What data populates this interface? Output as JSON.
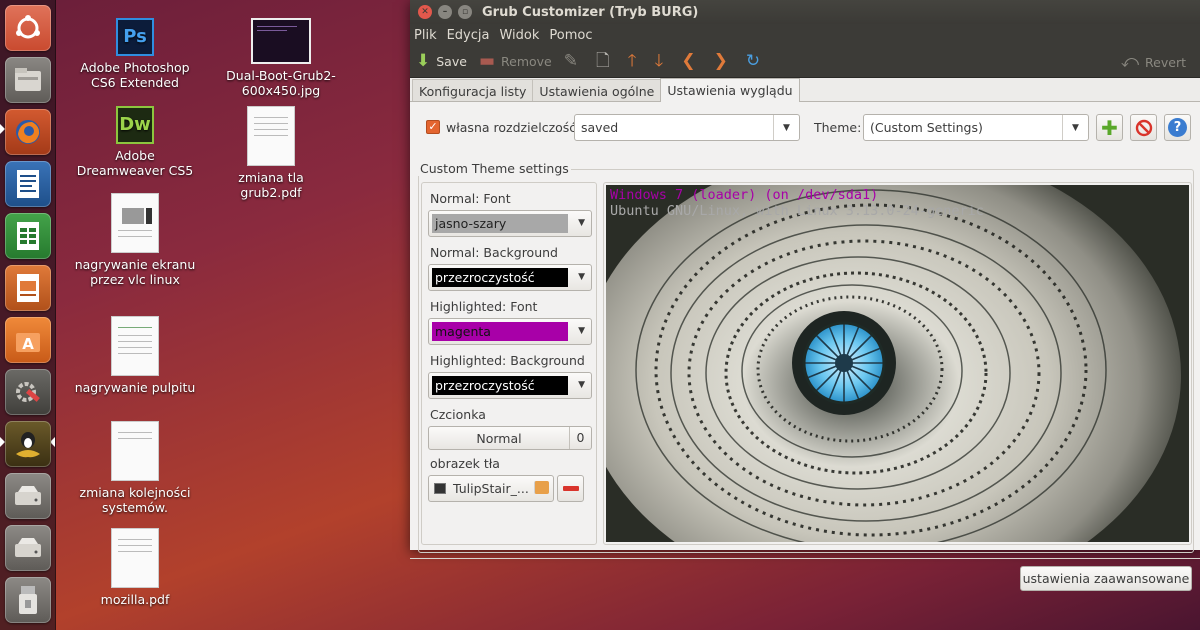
{
  "desktop": {
    "icons": [
      {
        "label": "Adobe Photoshop CS6 Extended",
        "glyph": "Ps"
      },
      {
        "label": "Adobe Dreamweaver CS5",
        "glyph": "Dw"
      },
      {
        "label": "nagrywanie ekranu przez vlc linux"
      },
      {
        "label": "nagrywanie pulpitu"
      },
      {
        "label": "zmiana kolejności systemów."
      },
      {
        "label": "mozilla.pdf"
      },
      {
        "label": "Dual-Boot-Grub2-600x450.jpg"
      },
      {
        "label": "zmiana tla grub2.pdf"
      }
    ]
  },
  "launcher": {
    "items": [
      "ubuntu-dash-icon",
      "files-icon",
      "firefox-icon",
      "writer-icon",
      "calc-icon",
      "impress-icon",
      "software-center-icon",
      "system-settings-icon",
      "grub-customizer-icon",
      "drive-icon",
      "drive-icon",
      "usb-drive-icon"
    ]
  },
  "window": {
    "title": "Grub Customizer (Tryb BURG)",
    "menu": [
      "Plik",
      "Edycja",
      "Widok",
      "Pomoc"
    ],
    "toolbar": {
      "save": "Save",
      "remove": "Remove",
      "revert": "Revert"
    },
    "tabs": [
      "Konfiguracja listy",
      "Ustawienia ogólne",
      "Ustawienia wyglądu"
    ],
    "active_tab": 2,
    "resolution": {
      "checkbox_label": "własna rozdzielczość:",
      "checked": true,
      "value": "saved"
    },
    "theme": {
      "label": "Theme:",
      "value": "(Custom Settings)"
    },
    "custom": {
      "group_title": "Custom Theme settings",
      "normal_font_label": "Normal: Font",
      "normal_font_value": "jasno-szary",
      "normal_font_color": "#a8a8a8",
      "normal_bg_label": "Normal: Background",
      "normal_bg_value": "przezroczystość",
      "normal_bg_color": "#000000",
      "hl_font_label": "Highlighted: Font",
      "hl_font_value": "magenta",
      "hl_font_color": "#a800a8",
      "hl_bg_label": "Highlighted: Background",
      "hl_bg_value": "przezroczystość",
      "hl_bg_color": "#000000",
      "font_label": "Czcionka",
      "font_name": "Normal",
      "font_size": "0",
      "bg_label": "obrazek tła",
      "bg_file": "TulipStair_..."
    },
    "preview": {
      "line1": "Windows 7 (loader) (on /dev/sda1)",
      "line2": "Ubuntu GNU/Linux, with Linux 3.13.0-24-generic"
    },
    "advanced_button": "ustawienia zaawansowane"
  }
}
